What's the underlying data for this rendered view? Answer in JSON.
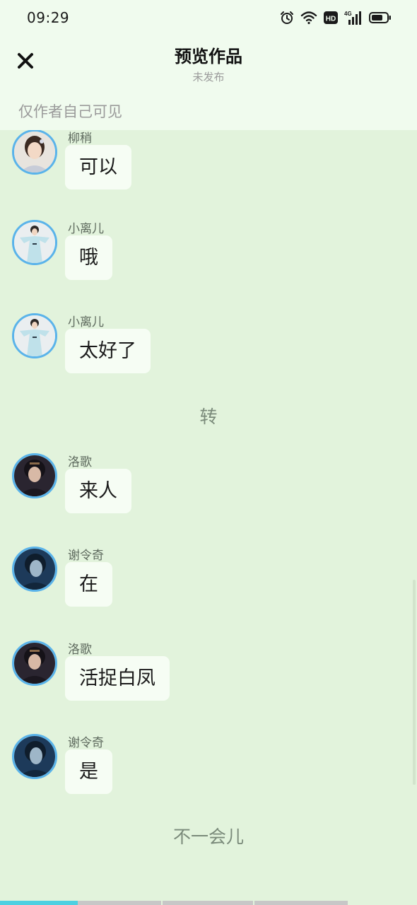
{
  "status_bar": {
    "time": "09:29",
    "icons": [
      "alarm-icon",
      "wifi-icon",
      "hd-icon",
      "signal-4g-icon",
      "battery-icon"
    ],
    "hd_label": "HD",
    "network_label": "4G"
  },
  "header": {
    "close_icon": "close-icon",
    "title": "预览作品",
    "subtitle": "未发布"
  },
  "visibility_note": "仅作者自己可见",
  "messages": [
    {
      "sender": "柳稍",
      "text": "可以"
    },
    {
      "sender": "小离儿",
      "text": "哦"
    },
    {
      "sender": "小离儿",
      "text": "太好了"
    },
    {
      "sender": "洛歌",
      "text": "来人"
    },
    {
      "sender": "谢令奇",
      "text": "在"
    },
    {
      "sender": "洛歌",
      "text": "活捉白凤"
    },
    {
      "sender": "谢令奇",
      "text": "是"
    }
  ],
  "narrations": [
    "转",
    "不一会儿"
  ],
  "colors": {
    "background": "#e2f3dc",
    "header_bg": "#f0fbee",
    "bubble_bg": "#f6fdf4",
    "avatar_border": "#5ab3ea",
    "progress_accent": "#4dd0e1",
    "progress_track": "#c7c7c7"
  },
  "progress": {
    "segments": 4,
    "current_segment": 1
  }
}
